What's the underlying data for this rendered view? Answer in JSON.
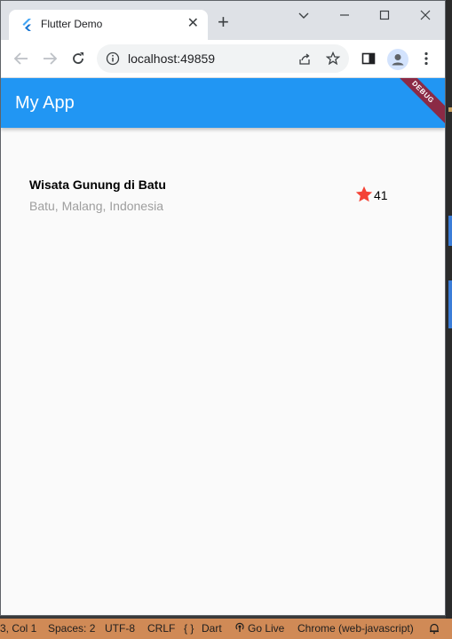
{
  "browser": {
    "tab_title": "Flutter Demo",
    "url": "localhost:49859"
  },
  "app": {
    "title": "My App",
    "debug_banner": "DEBUG"
  },
  "item": {
    "title": "Wisata Gunung di Batu",
    "subtitle": "Batu, Malang, Indonesia",
    "star_count": "41",
    "star_color": "#f44336"
  },
  "theme": {
    "appbar_color": "#2196f3",
    "statusbar_color": "#d08a56"
  },
  "statusbar": {
    "position": "3, Col 1",
    "spaces": "Spaces: 2",
    "encoding": "UTF-8",
    "eol": "CRLF",
    "language": "Dart",
    "go_live": "Go Live",
    "target": "Chrome (web-javascript)"
  }
}
